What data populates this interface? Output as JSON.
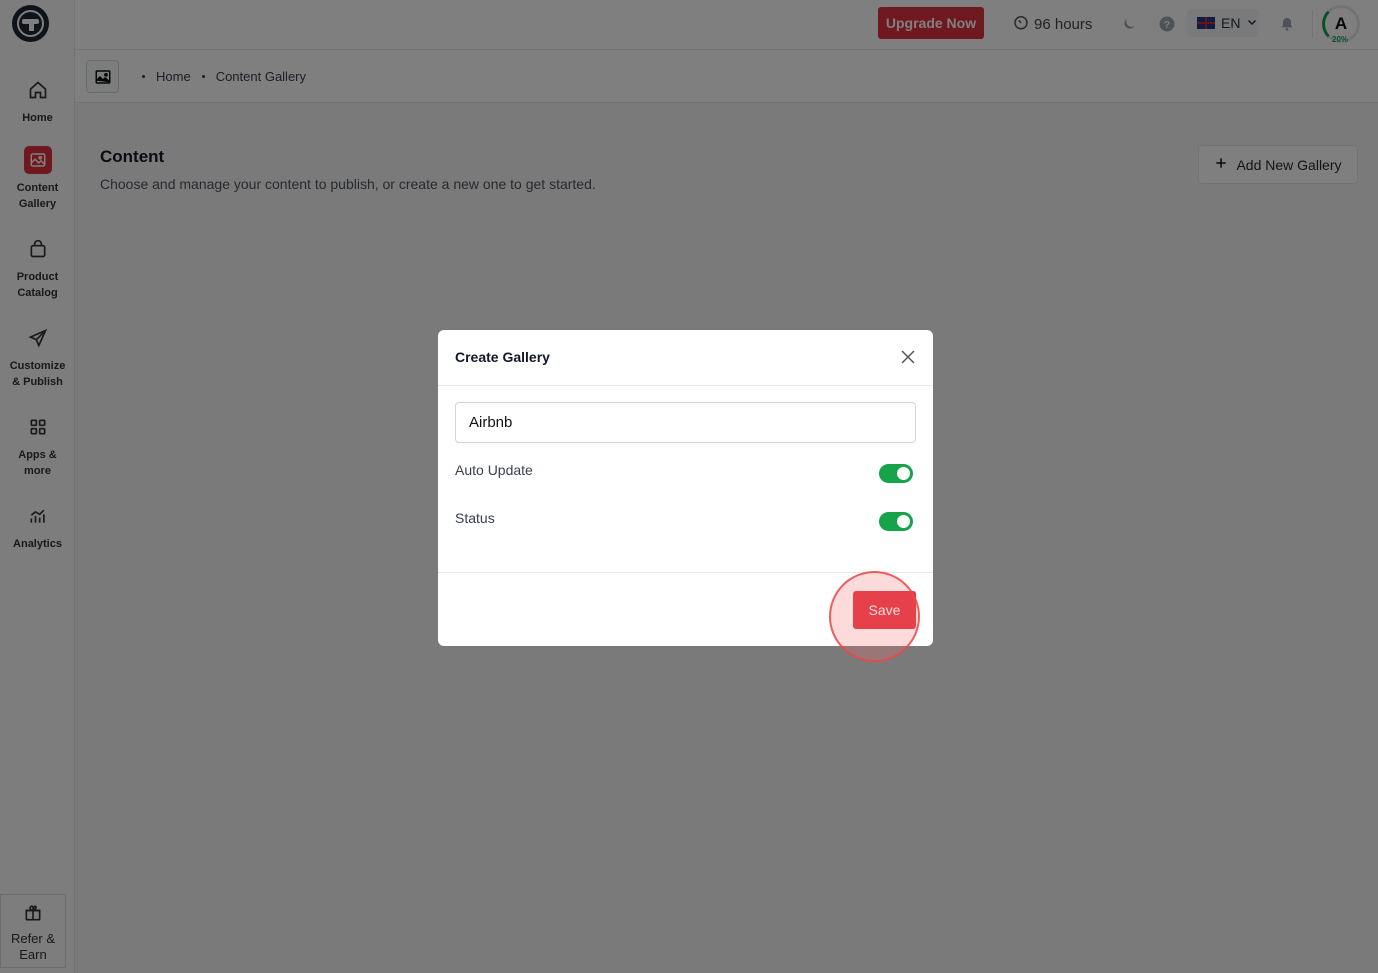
{
  "topbar": {
    "upgrade_label": "Upgrade Now",
    "hours_label": "96 hours",
    "language": "EN",
    "avatar_letter": "A",
    "avatar_progress": "20%"
  },
  "sidebar": {
    "items": [
      {
        "label": "Home",
        "icon": "home-icon"
      },
      {
        "label": "Content\nGallery",
        "icon": "image-icon"
      },
      {
        "label": "Product\nCatalog",
        "icon": "bag-icon"
      },
      {
        "label": "Customize\n& Publish",
        "icon": "send-icon"
      },
      {
        "label": "Apps &\nmore",
        "icon": "grid-icon"
      },
      {
        "label": "Analytics",
        "icon": "chart-icon"
      }
    ],
    "refer_label": "Refer &\nEarn"
  },
  "breadcrumb": {
    "items": [
      "Home",
      "Content Gallery"
    ]
  },
  "main": {
    "title": "Content",
    "subtitle": "Choose and manage your content to publish, or create a new one to get started.",
    "add_button": "Add New Gallery"
  },
  "modal": {
    "title": "Create Gallery",
    "name_value": "Airbnb",
    "auto_update_label": "Auto Update",
    "status_label": "Status",
    "save_label": "Save"
  },
  "colors": {
    "accent": "#e0313f",
    "toggle_on": "#16a34a"
  }
}
